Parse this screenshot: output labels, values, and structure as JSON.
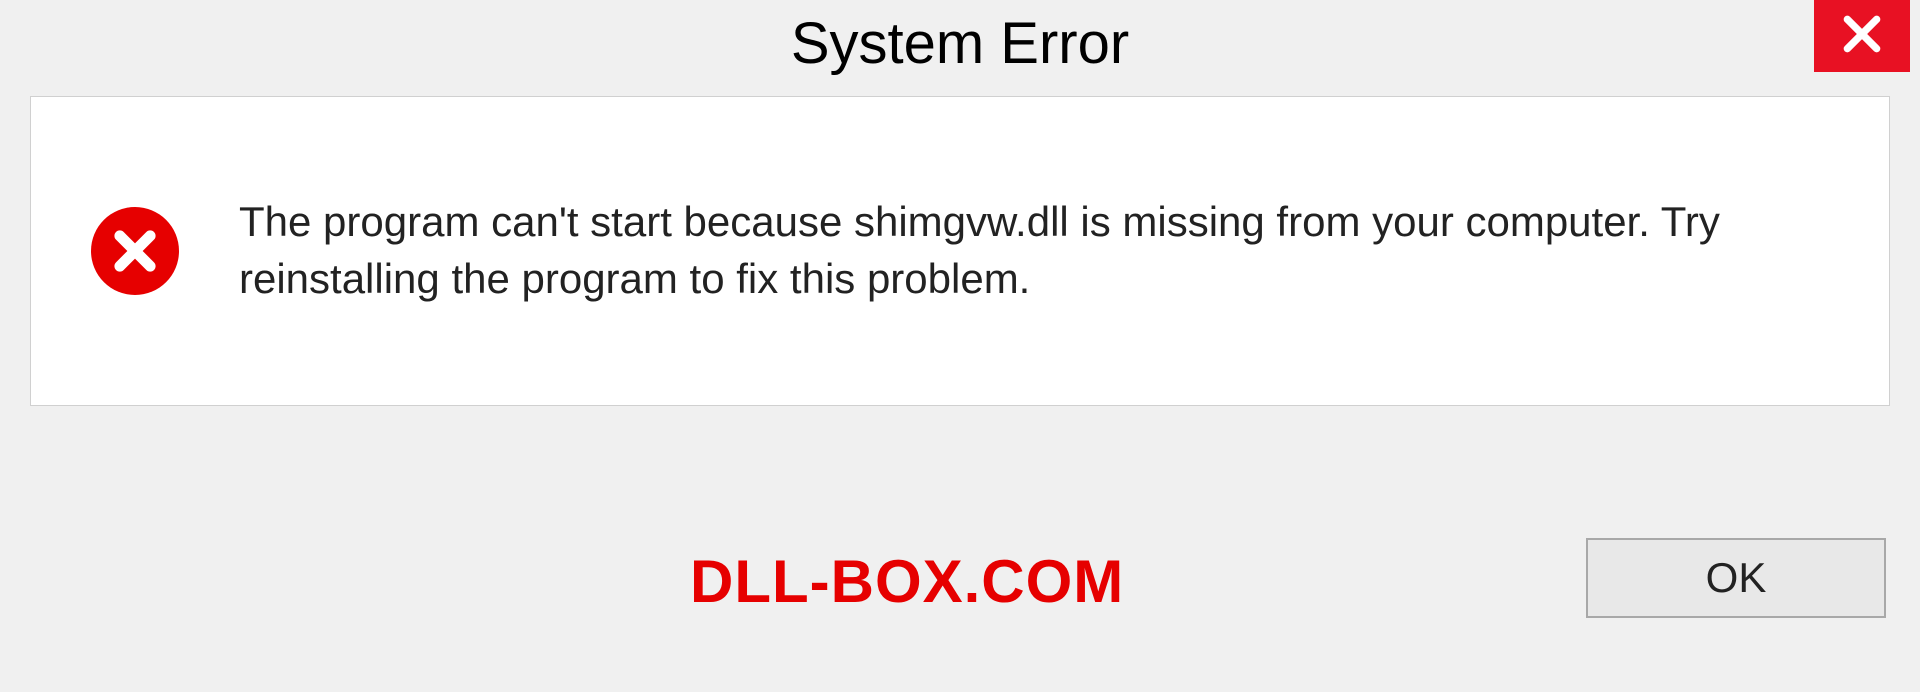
{
  "dialog": {
    "title": "System Error",
    "message": "The program can't start because shimgvw.dll is missing from your computer. Try reinstalling the program to fix this problem.",
    "ok_label": "OK"
  },
  "watermark": "DLL-BOX.COM"
}
